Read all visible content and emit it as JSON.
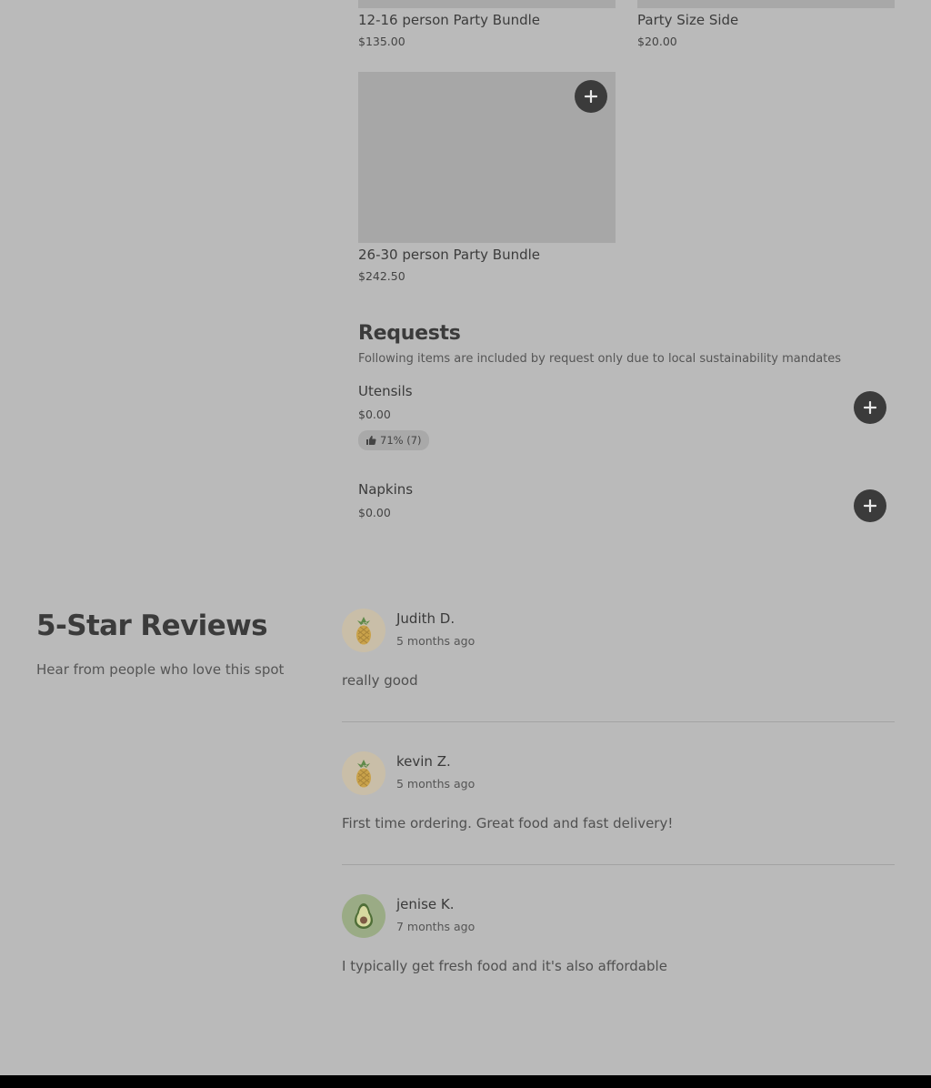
{
  "menu_items": [
    {
      "title": "12-16 person Party Bundle",
      "price": "$135.00"
    },
    {
      "title": "Party Size Side",
      "price": "$20.00"
    },
    {
      "title": "26-30 person Party Bundle",
      "price": "$242.50"
    }
  ],
  "requests": {
    "title": "Requests",
    "subtitle": "Following items are included by request only due to local sustainability mandates",
    "items": [
      {
        "name": "Utensils",
        "price": "$0.00",
        "rating": "71% (7)"
      },
      {
        "name": "Napkins",
        "price": "$0.00"
      }
    ]
  },
  "reviews": {
    "title": "5-Star Reviews",
    "subtitle": "Hear from people who love this spot",
    "items": [
      {
        "name": "Judith D.",
        "time": "5 months ago",
        "text": "really good",
        "avatar": "pineapple-icon"
      },
      {
        "name": "kevin Z.",
        "time": "5 months ago",
        "text": "First time ordering. Great food and fast delivery!",
        "avatar": "pineapple-icon"
      },
      {
        "name": "jenise K.",
        "time": "7 months ago",
        "text": "I typically get fresh food and it's also affordable",
        "avatar": "avocado-icon"
      }
    ]
  },
  "colors": {
    "overlay_background": "#bababa",
    "button": "#3b3b3b",
    "pineapple_avatar_bg": "#c9bea8",
    "avocado_avatar_bg": "#9aab85"
  }
}
